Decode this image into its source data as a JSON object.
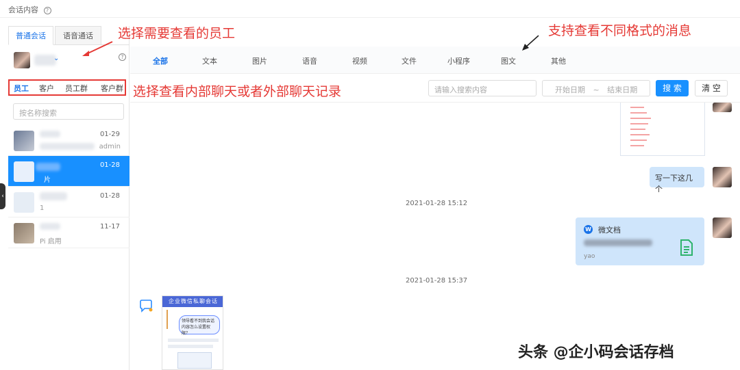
{
  "topbar": {
    "title": "会话内容",
    "help_icon": "question-icon"
  },
  "left": {
    "tabs": [
      {
        "label": "普通会话",
        "active": true
      },
      {
        "label": "语音通话",
        "active": false
      }
    ],
    "subtabs": [
      {
        "label": "员工",
        "active": true
      },
      {
        "label": "客户",
        "active": false
      },
      {
        "label": "员工群",
        "active": false
      },
      {
        "label": "客户群",
        "active": false
      }
    ],
    "name_search": {
      "placeholder": "按名称搜索"
    },
    "contacts": [
      {
        "date": "01-29",
        "preview": "admin",
        "active": false
      },
      {
        "date": "01-28",
        "preview": "片",
        "active": true
      },
      {
        "date": "01-28",
        "preview": "1",
        "active": false
      },
      {
        "date": "11-17",
        "preview": "Pi             启用",
        "active": false
      }
    ]
  },
  "filter": {
    "tabs": [
      {
        "label": "全部",
        "active": true
      },
      {
        "label": "文本",
        "active": false
      },
      {
        "label": "图片",
        "active": false
      },
      {
        "label": "语音",
        "active": false
      },
      {
        "label": "视频",
        "active": false
      },
      {
        "label": "文件",
        "active": false
      },
      {
        "label": "小程序",
        "active": false
      },
      {
        "label": "图文",
        "active": false
      },
      {
        "label": "其他",
        "active": false
      }
    ]
  },
  "search": {
    "placeholder": "请输入搜索内容",
    "start_date": "开始日期",
    "separator": "~",
    "end_date": "结束日期",
    "search_button": "搜 索",
    "clear_button": "清 空"
  },
  "chat": {
    "messages": [
      {
        "type": "text",
        "text": "写一下这几个"
      },
      {
        "type": "timestamp",
        "text": "2021-01-28 15:12"
      },
      {
        "type": "file-card",
        "title": "微文档",
        "sub": "yao"
      },
      {
        "type": "timestamp",
        "text": "2021-01-28 15:37"
      }
    ],
    "poster": {
      "header": "企业微信私聊会话",
      "question": "领导看不到我会话内容怎么设置权限？"
    }
  },
  "annotations": {
    "select_employee": "选择需要查看的员工",
    "formats": "支持查看不同格式的消息",
    "internal_external": "选择查看内部聊天或者外部聊天记录"
  },
  "watermark": "头条 @企小码会话存档",
  "colors": {
    "accent": "#1890ff",
    "annotation": "#e53935",
    "bubble": "#cfe5fb"
  }
}
